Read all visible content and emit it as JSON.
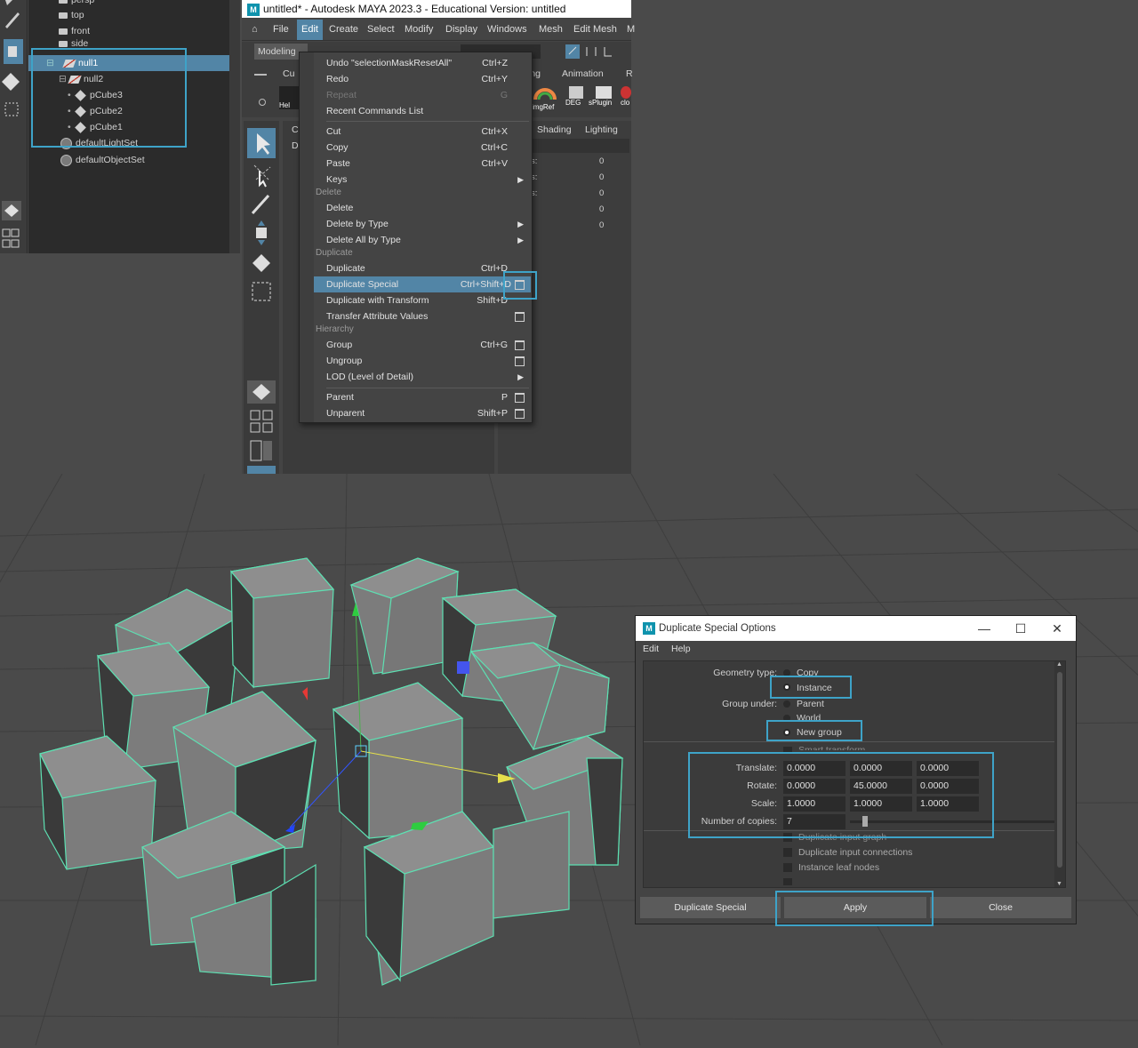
{
  "outliner": {
    "items": [
      {
        "label": "persp",
        "type": "camera"
      },
      {
        "label": "top",
        "type": "camera"
      },
      {
        "label": "front",
        "type": "camera"
      },
      {
        "label": "side",
        "type": "camera"
      },
      {
        "label": "null1",
        "type": "group",
        "selected": true
      },
      {
        "label": "null2",
        "type": "group"
      },
      {
        "label": "pCube3",
        "type": "mesh"
      },
      {
        "label": "pCube2",
        "type": "mesh"
      },
      {
        "label": "pCube1",
        "type": "mesh"
      },
      {
        "label": "defaultLightSet",
        "type": "set"
      },
      {
        "label": "defaultObjectSet",
        "type": "set"
      }
    ]
  },
  "window": {
    "title": "untitled* - Autodesk MAYA 2023.3 - Educational Version: untitled",
    "logo": "M"
  },
  "menubar": {
    "items": [
      "File",
      "Edit",
      "Create",
      "Select",
      "Modify",
      "Display",
      "Windows",
      "Mesh",
      "Edit Mesh",
      "M"
    ],
    "active": "Edit"
  },
  "shelf": {
    "workspace": "Modeling",
    "tabs": [
      "Cu",
      "ing",
      "Animation",
      "R"
    ],
    "buttons": [
      "Hel",
      "imgRef",
      "DEG",
      "sPlugin",
      "clo"
    ]
  },
  "panel_menu": [
    "Shading",
    "Lighting"
  ],
  "midpanel": {
    "letters": [
      "C",
      "D"
    ]
  },
  "channel_values": [
    "0",
    "0",
    "0",
    "0",
    "0"
  ],
  "channel_labels": [
    "s:",
    "s:",
    "s:"
  ],
  "edit_menu": {
    "items": [
      {
        "kind": "item",
        "label": "Undo \"selectionMaskResetAll\"",
        "shortcut": "Ctrl+Z"
      },
      {
        "kind": "item",
        "label": "Redo",
        "shortcut": "Ctrl+Y"
      },
      {
        "kind": "item",
        "label": "Repeat",
        "shortcut": "G",
        "disabled": true
      },
      {
        "kind": "item",
        "label": "Recent Commands List",
        "shortcut": ""
      },
      {
        "kind": "sep"
      },
      {
        "kind": "item",
        "label": "Cut",
        "shortcut": "Ctrl+X"
      },
      {
        "kind": "item",
        "label": "Copy",
        "shortcut": "Ctrl+C"
      },
      {
        "kind": "item",
        "label": "Paste",
        "shortcut": "Ctrl+V"
      },
      {
        "kind": "item",
        "label": "Keys",
        "shortcut": "",
        "submenu": true
      },
      {
        "kind": "section",
        "label": "Delete"
      },
      {
        "kind": "item",
        "label": "Delete",
        "shortcut": ""
      },
      {
        "kind": "item",
        "label": "Delete by Type",
        "shortcut": "",
        "submenu": true
      },
      {
        "kind": "item",
        "label": "Delete All by Type",
        "shortcut": "",
        "submenu": true
      },
      {
        "kind": "section",
        "label": "Duplicate"
      },
      {
        "kind": "item",
        "label": "Duplicate",
        "shortcut": "Ctrl+D"
      },
      {
        "kind": "item",
        "label": "Duplicate Special",
        "shortcut": "Ctrl+Shift+D",
        "option": true,
        "selected": true
      },
      {
        "kind": "item",
        "label": "Duplicate with Transform",
        "shortcut": "Shift+D"
      },
      {
        "kind": "item",
        "label": "Transfer Attribute Values",
        "shortcut": "",
        "option": true
      },
      {
        "kind": "section",
        "label": "Hierarchy"
      },
      {
        "kind": "item",
        "label": "Group",
        "shortcut": "Ctrl+G",
        "option": true
      },
      {
        "kind": "item",
        "label": "Ungroup",
        "shortcut": "",
        "option": true
      },
      {
        "kind": "item",
        "label": "LOD (Level of Detail)",
        "shortcut": "",
        "submenu": true
      },
      {
        "kind": "sep"
      },
      {
        "kind": "item",
        "label": "Parent",
        "shortcut": "P",
        "option": true
      },
      {
        "kind": "item",
        "label": "Unparent",
        "shortcut": "Shift+P",
        "option": true
      }
    ]
  },
  "dialog": {
    "title": "Duplicate Special Options",
    "menu": [
      "Edit",
      "Help"
    ],
    "geometry_type_label": "Geometry type:",
    "geometry_options": [
      {
        "label": "Copy",
        "on": false
      },
      {
        "label": "Instance",
        "on": true
      }
    ],
    "group_under_label": "Group under:",
    "group_options": [
      {
        "label": "Parent",
        "on": false
      },
      {
        "label": "World",
        "on": false
      },
      {
        "label": "New group",
        "on": true
      }
    ],
    "smart_transform": "Smart transform",
    "translate_label": "Translate:",
    "translate": [
      "0.0000",
      "0.0000",
      "0.0000"
    ],
    "rotate_label": "Rotate:",
    "rotate": [
      "0.0000",
      "45.0000",
      "0.0000"
    ],
    "scale_label": "Scale:",
    "scale": [
      "1.0000",
      "1.0000",
      "1.0000"
    ],
    "copies_label": "Number of copies:",
    "copies": "7",
    "checkboxes": [
      "Duplicate input graph",
      "Duplicate input connections",
      "Instance leaf nodes"
    ],
    "buttons": [
      "Duplicate Special",
      "Apply",
      "Close"
    ]
  },
  "colors": {
    "accent": "#5285a6",
    "highlight": "#3ea3c8",
    "wire": "#5de0b2"
  }
}
